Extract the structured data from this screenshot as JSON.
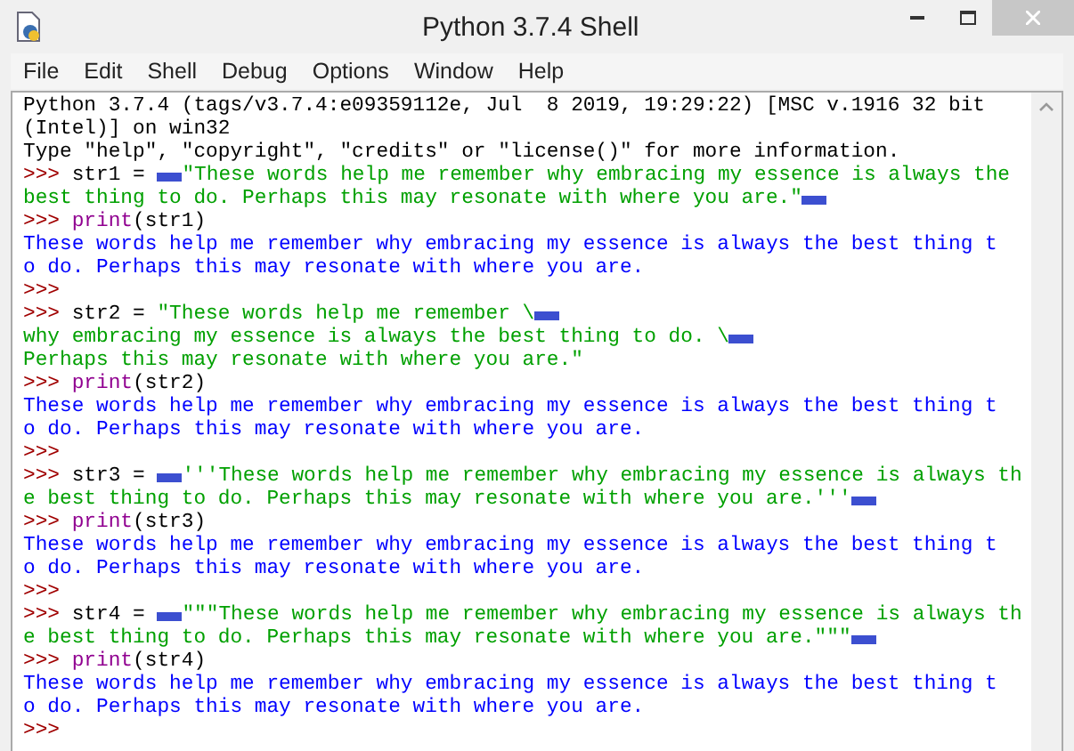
{
  "window": {
    "title": "Python 3.7.4 Shell"
  },
  "menu": [
    "File",
    "Edit",
    "Shell",
    "Debug",
    "Options",
    "Window",
    "Help"
  ],
  "shell_lines": [
    [
      {
        "kind": "plain",
        "text": "Python 3.7.4 (tags/v3.7.4:e09359112e, Jul  8 2019, 19:29:22) [MSC v.1916 32 bit"
      }
    ],
    [
      {
        "kind": "plain",
        "text": "(Intel)] on win32"
      }
    ],
    [
      {
        "kind": "plain",
        "text": "Type \"help\", \"copyright\", \"credits\" or \"license()\" for more information."
      }
    ],
    [
      {
        "kind": "prompt",
        "text": ">>> "
      },
      {
        "kind": "plain",
        "text": "str1 = "
      },
      {
        "kind": "mark"
      },
      {
        "kind": "string",
        "text": "\"These words help me remember why embracing my essence is always the"
      }
    ],
    [
      {
        "kind": "string",
        "text": "best thing to do. Perhaps this may resonate with where you are.\""
      },
      {
        "kind": "mark"
      }
    ],
    [
      {
        "kind": "prompt",
        "text": ">>> "
      },
      {
        "kind": "builtin",
        "text": "print"
      },
      {
        "kind": "plain",
        "text": "(str1)"
      }
    ],
    [
      {
        "kind": "output",
        "text": "These words help me remember why embracing my essence is always the best thing t"
      }
    ],
    [
      {
        "kind": "output",
        "text": "o do. Perhaps this may resonate with where you are."
      }
    ],
    [
      {
        "kind": "prompt",
        "text": ">>>"
      }
    ],
    [
      {
        "kind": "prompt",
        "text": ">>> "
      },
      {
        "kind": "plain",
        "text": "str2 = "
      },
      {
        "kind": "string",
        "text": "\"These words help me remember \\"
      },
      {
        "kind": "mark"
      }
    ],
    [
      {
        "kind": "string",
        "text": "why embracing my essence is always the best thing to do. \\"
      },
      {
        "kind": "mark"
      }
    ],
    [
      {
        "kind": "string",
        "text": "Perhaps this may resonate with where you are.\""
      }
    ],
    [
      {
        "kind": "prompt",
        "text": ">>> "
      },
      {
        "kind": "builtin",
        "text": "print"
      },
      {
        "kind": "plain",
        "text": "(str2)"
      }
    ],
    [
      {
        "kind": "output",
        "text": "These words help me remember why embracing my essence is always the best thing t"
      }
    ],
    [
      {
        "kind": "output",
        "text": "o do. Perhaps this may resonate with where you are."
      }
    ],
    [
      {
        "kind": "prompt",
        "text": ">>>"
      }
    ],
    [
      {
        "kind": "prompt",
        "text": ">>> "
      },
      {
        "kind": "plain",
        "text": "str3 = "
      },
      {
        "kind": "mark"
      },
      {
        "kind": "string",
        "text": "'''These words help me remember why embracing my essence is always th"
      }
    ],
    [
      {
        "kind": "string",
        "text": "e best thing to do. Perhaps this may resonate with where you are.'''"
      },
      {
        "kind": "mark"
      }
    ],
    [
      {
        "kind": "prompt",
        "text": ">>> "
      },
      {
        "kind": "builtin",
        "text": "print"
      },
      {
        "kind": "plain",
        "text": "(str3)"
      }
    ],
    [
      {
        "kind": "output",
        "text": "These words help me remember why embracing my essence is always the best thing t"
      }
    ],
    [
      {
        "kind": "output",
        "text": "o do. Perhaps this may resonate with where you are."
      }
    ],
    [
      {
        "kind": "prompt",
        "text": ">>>"
      }
    ],
    [
      {
        "kind": "prompt",
        "text": ">>> "
      },
      {
        "kind": "plain",
        "text": "str4 = "
      },
      {
        "kind": "mark"
      },
      {
        "kind": "string",
        "text": "\"\"\"These words help me remember why embracing my essence is always th"
      }
    ],
    [
      {
        "kind": "string",
        "text": "e best thing to do. Perhaps this may resonate with where you are.\"\"\""
      },
      {
        "kind": "mark"
      }
    ],
    [
      {
        "kind": "prompt",
        "text": ">>> "
      },
      {
        "kind": "builtin",
        "text": "print"
      },
      {
        "kind": "plain",
        "text": "(str4)"
      }
    ],
    [
      {
        "kind": "output",
        "text": "These words help me remember why embracing my essence is always the best thing t"
      }
    ],
    [
      {
        "kind": "output",
        "text": "o do. Perhaps this may resonate with where you are."
      }
    ],
    [
      {
        "kind": "prompt",
        "text": ">>>"
      }
    ]
  ]
}
